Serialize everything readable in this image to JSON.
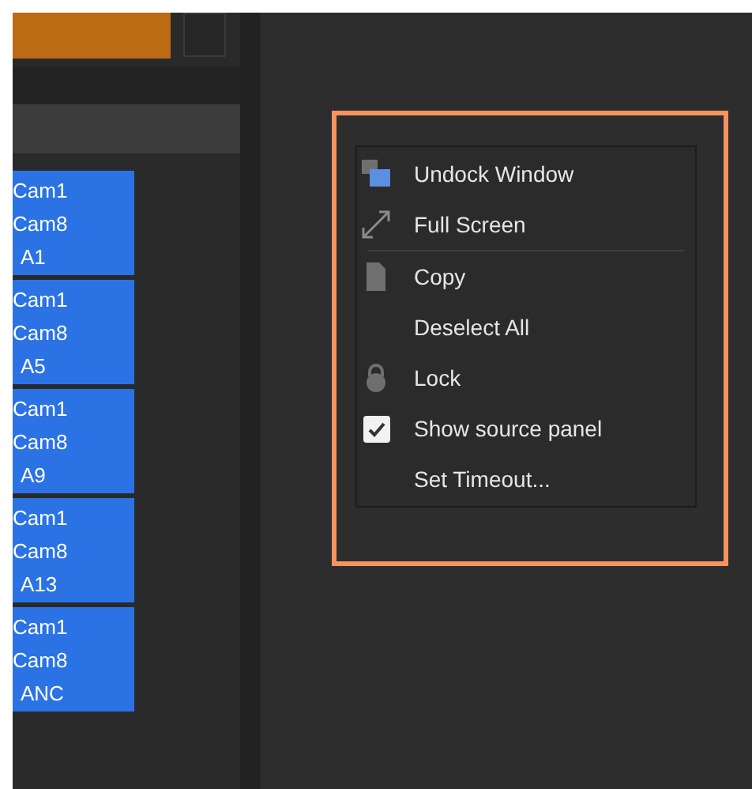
{
  "tiles": [
    {
      "lines": [
        "Cam1",
        "Cam8",
        "A1"
      ]
    },
    {
      "lines": [
        "Cam1",
        "Cam8",
        "A5"
      ]
    },
    {
      "lines": [
        "Cam1",
        "Cam8",
        "A9"
      ]
    },
    {
      "lines": [
        "Cam1",
        "Cam8",
        "A13"
      ]
    },
    {
      "lines": [
        "Cam1",
        "Cam8",
        "ANC"
      ]
    }
  ],
  "context_menu": {
    "items": [
      {
        "kind": "undock",
        "label": "Undock Window",
        "separator_after": false
      },
      {
        "kind": "fullscreen",
        "label": "Full Screen",
        "separator_after": true
      },
      {
        "kind": "copy",
        "label": "Copy",
        "separator_after": false
      },
      {
        "kind": "plain",
        "label": "Deselect All",
        "separator_after": false
      },
      {
        "kind": "lock",
        "label": "Lock",
        "separator_after": false
      },
      {
        "kind": "check",
        "label": "Show source panel",
        "checked": true,
        "separator_after": false
      },
      {
        "kind": "plain",
        "label": "Set Timeout...",
        "separator_after": false
      }
    ]
  }
}
